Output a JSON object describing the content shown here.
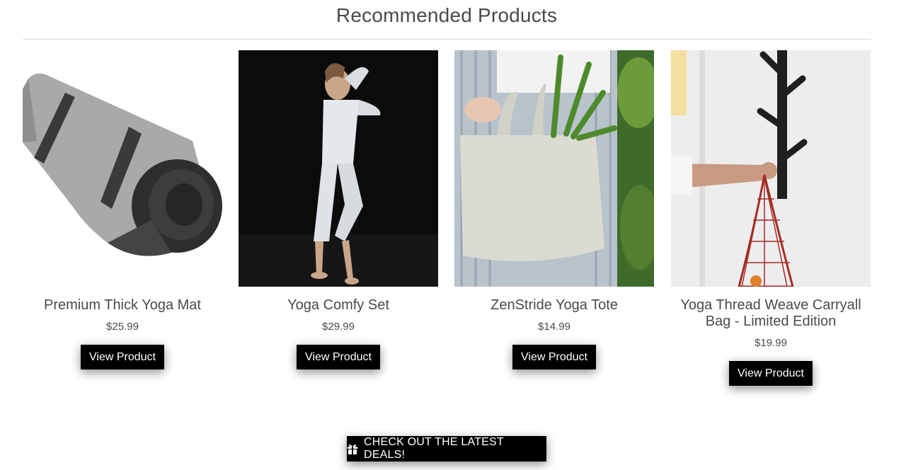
{
  "section": {
    "title": "Recommended Products"
  },
  "products": [
    {
      "name": "Premium Thick Yoga Mat",
      "price": "$25.99",
      "button_label": "View Product",
      "image": "rolled-yoga-mat-photo"
    },
    {
      "name": "Yoga Comfy Set",
      "price": "$29.99",
      "button_label": "View Product",
      "image": "woman-in-white-outfit-photo"
    },
    {
      "name": "ZenStride Yoga Tote",
      "price": "$14.99",
      "button_label": "View Product",
      "image": "canvas-tote-bag-photo"
    },
    {
      "name": "Yoga Thread Weave Carryall Bag - Limited Edition",
      "price": "$19.99",
      "button_label": "View Product",
      "image": "red-mesh-bag-on-rack-photo"
    }
  ],
  "deals": {
    "label": "CHECK OUT THE LATEST DEALS!",
    "icon": "gift-icon"
  },
  "colors": {
    "button_bg": "#000000",
    "button_text": "#ffffff",
    "text": "#4a4a4a",
    "divider": "#dcdcdc"
  }
}
